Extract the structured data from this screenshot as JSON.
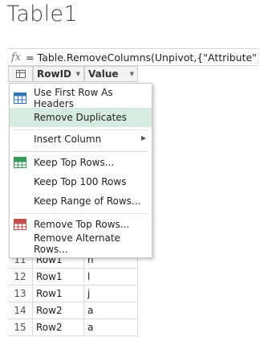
{
  "title": "Table1",
  "formula": {
    "fx_symbol": "fx",
    "text": "= Table.RemoveColumns(Unpivot,{\"Attribute\"})"
  },
  "columns": [
    "RowID",
    "Value"
  ],
  "rows": [
    {
      "num": "11",
      "rowid": "Row1",
      "value": "h"
    },
    {
      "num": "12",
      "rowid": "Row1",
      "value": "l"
    },
    {
      "num": "13",
      "rowid": "Row1",
      "value": "j"
    },
    {
      "num": "14",
      "rowid": "Row2",
      "value": "a"
    },
    {
      "num": "15",
      "rowid": "Row2",
      "value": "a"
    }
  ],
  "menu": {
    "items": [
      {
        "label": "Use First Row As Headers",
        "icon": "table-header-icon"
      },
      {
        "label": "Remove Duplicates",
        "highlighted": true
      },
      {
        "label": "Insert Column",
        "has_submenu": true
      },
      {
        "label": "Keep Top Rows...",
        "icon": "keep-rows-icon"
      },
      {
        "label": "Keep Top 100 Rows"
      },
      {
        "label": "Keep Range of Rows..."
      },
      {
        "label": "Remove Top Rows...",
        "icon": "remove-rows-icon"
      },
      {
        "label": "Remove Alternate Rows..."
      }
    ]
  },
  "colors": {
    "highlight": "#d6ebe2",
    "header_icon_blue": "#2e75b6",
    "keep_icon_green": "#3a9a5c",
    "remove_icon_red": "#c0504d"
  }
}
